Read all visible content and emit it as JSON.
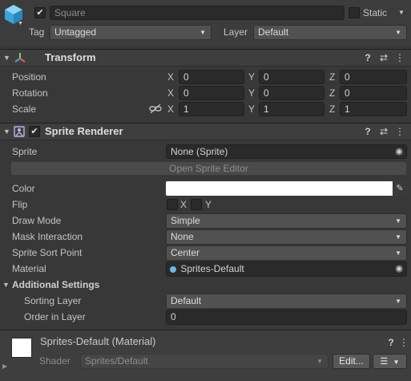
{
  "gameobject": {
    "icon": "cube-icon",
    "active_checked": "✔",
    "name": "Square",
    "static_label": "Static",
    "tag_label": "Tag",
    "tag_value": "Untagged",
    "layer_label": "Layer",
    "layer_value": "Default"
  },
  "transform": {
    "title": "Transform",
    "rows": [
      {
        "label": "Position",
        "x": "0",
        "y": "0",
        "z": "0"
      },
      {
        "label": "Rotation",
        "x": "0",
        "y": "0",
        "z": "0"
      },
      {
        "label": "Scale",
        "x": "1",
        "y": "1",
        "z": "1"
      }
    ],
    "axis_x": "X",
    "axis_y": "Y",
    "axis_z": "Z"
  },
  "sprite_renderer": {
    "title": "Sprite Renderer",
    "sprite_label": "Sprite",
    "sprite_value": "None (Sprite)",
    "open_editor": "Open Sprite Editor",
    "color_label": "Color",
    "color_value": "#ffffff",
    "flip_label": "Flip",
    "flip_x": "X",
    "flip_y": "Y",
    "draw_mode_label": "Draw Mode",
    "draw_mode_value": "Simple",
    "mask_label": "Mask Interaction",
    "mask_value": "None",
    "sort_point_label": "Sprite Sort Point",
    "sort_point_value": "Center",
    "material_label": "Material",
    "material_value": "Sprites-Default",
    "additional_label": "Additional Settings",
    "sorting_layer_label": "Sorting Layer",
    "sorting_layer_value": "Default",
    "order_label": "Order in Layer",
    "order_value": "0"
  },
  "material": {
    "title": "Sprites-Default (Material)",
    "shader_label": "Shader",
    "shader_value": "Sprites/Default",
    "edit_label": "Edit..."
  },
  "icons": {
    "help": "?",
    "presets": "⇄",
    "menu": "⋮",
    "caret": "▼",
    "fold_open": "▼",
    "fold_closed": "▶",
    "target": "◉",
    "eyedropper": "✎",
    "list": "☰"
  }
}
